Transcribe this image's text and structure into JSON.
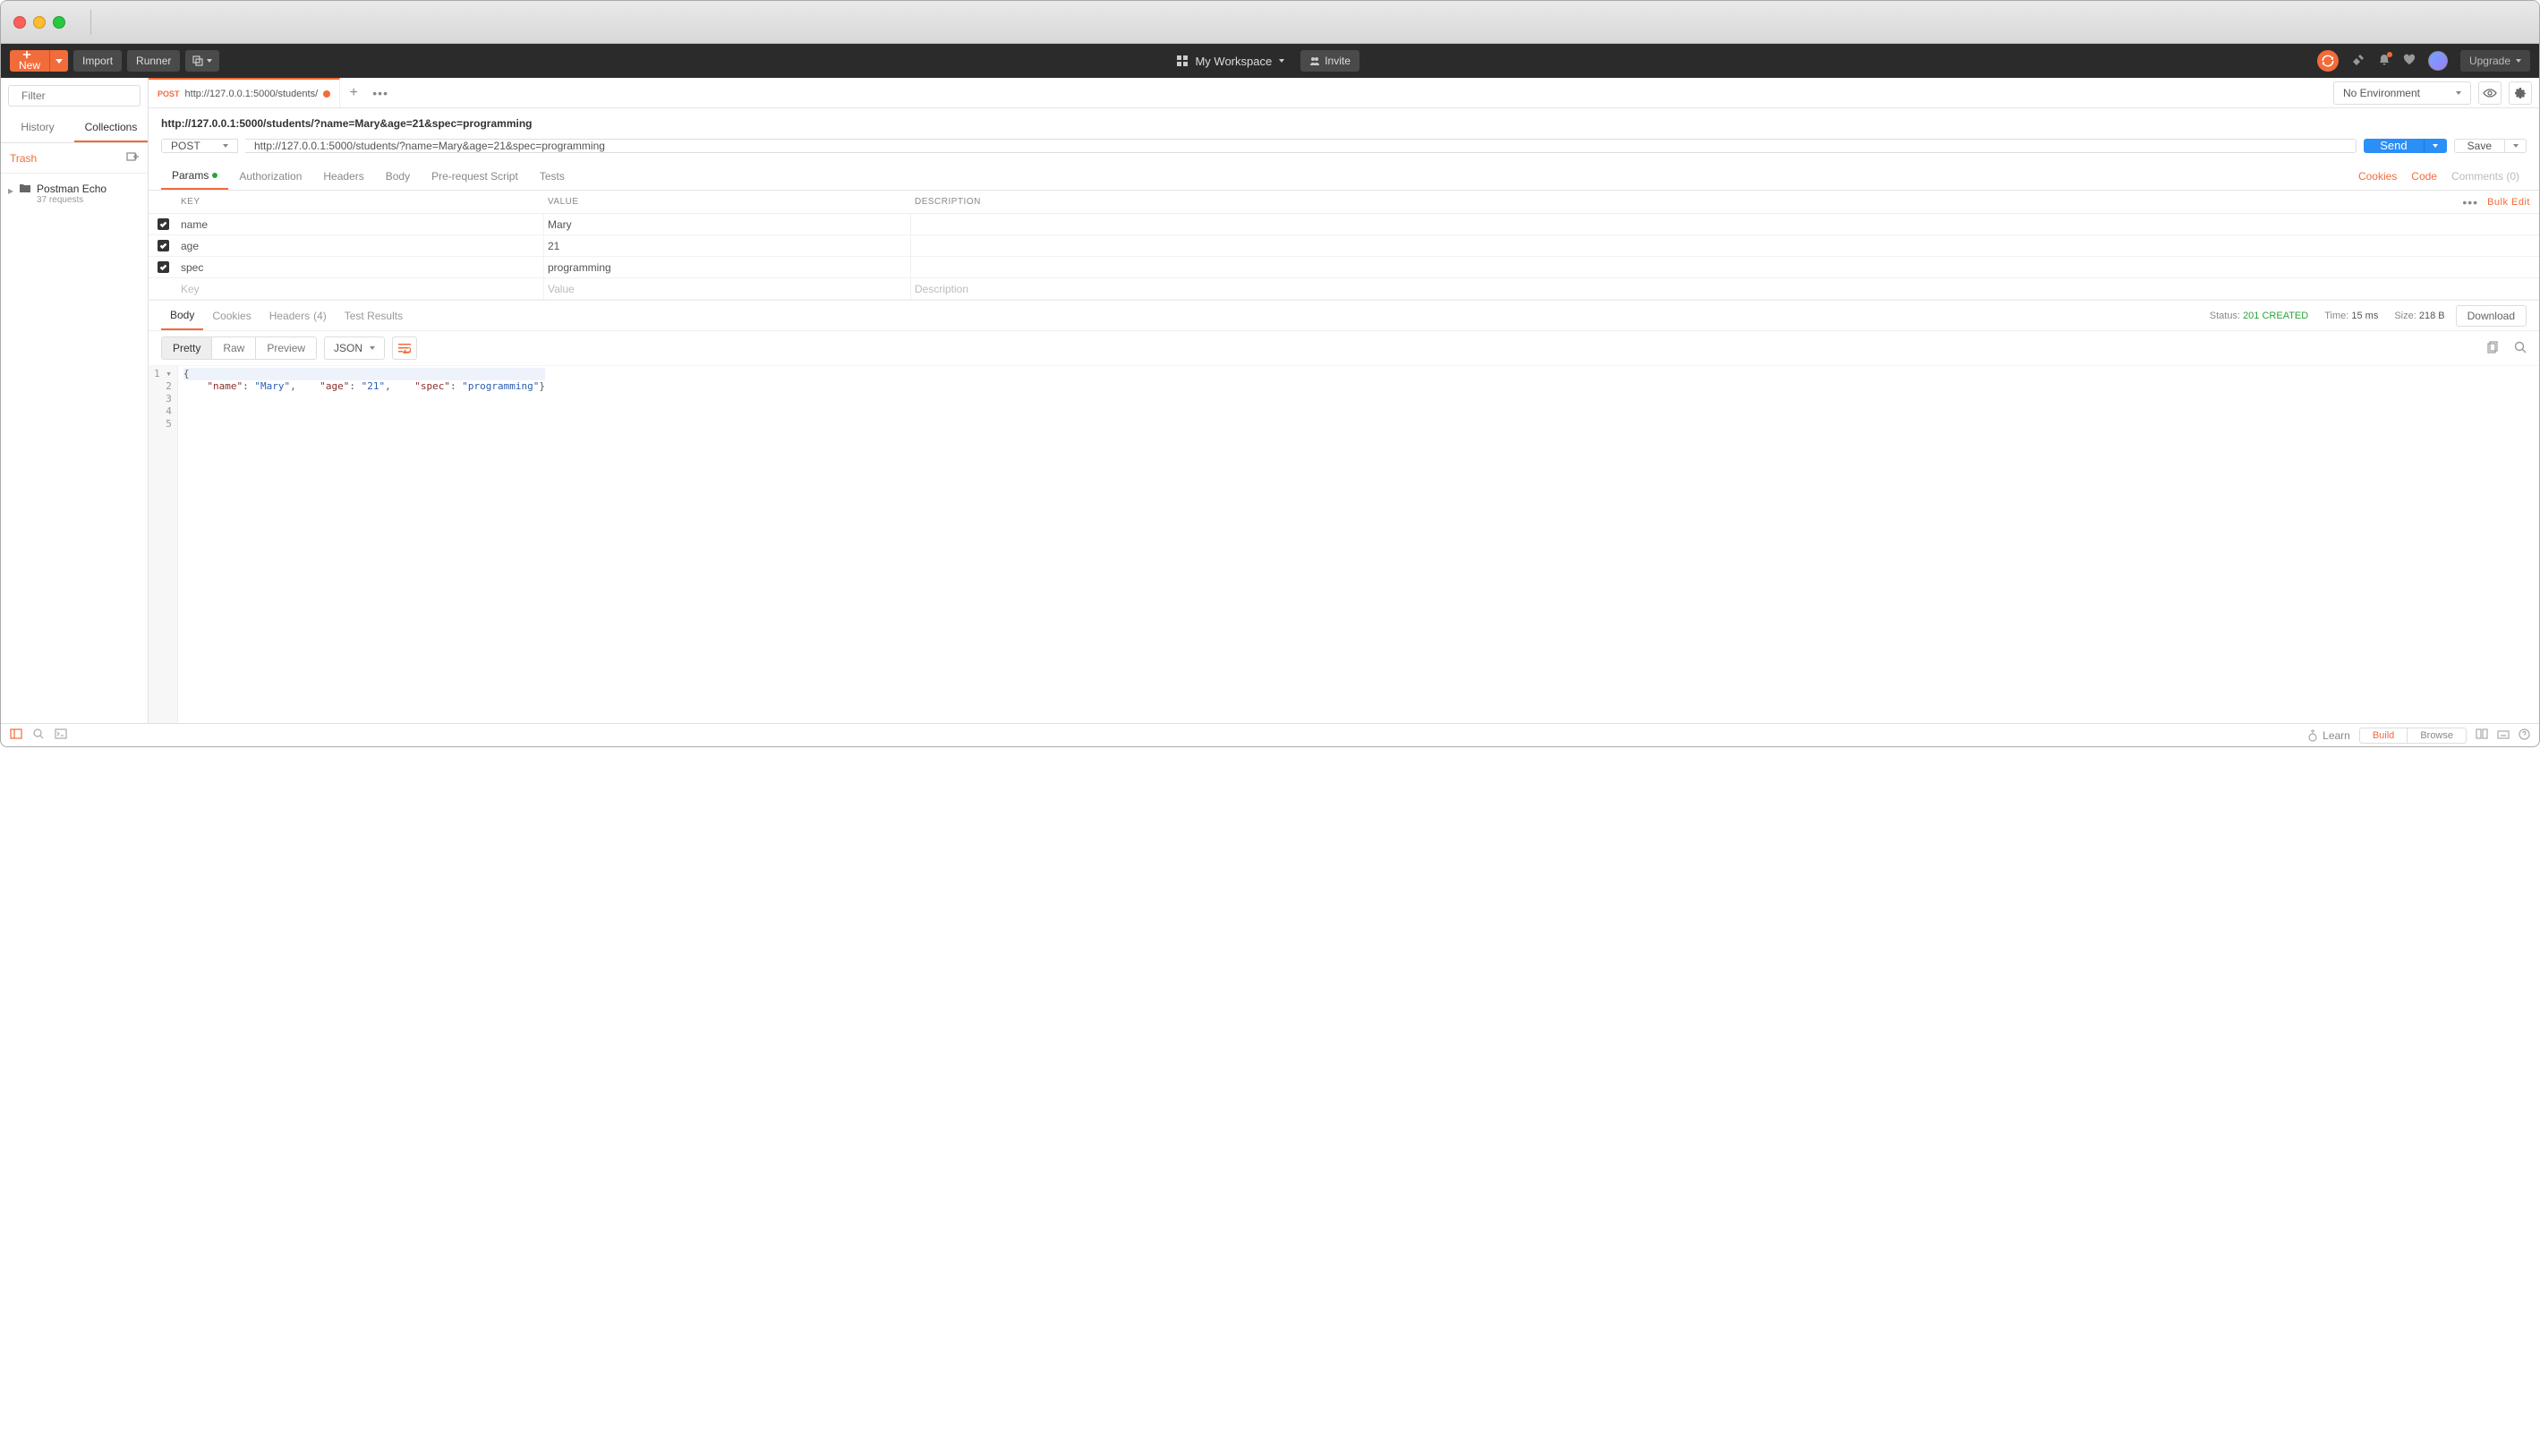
{
  "toolbar": {
    "new_label": "New",
    "import_label": "Import",
    "runner_label": "Runner",
    "workspace_label": "My Workspace",
    "invite_label": "Invite",
    "upgrade_label": "Upgrade"
  },
  "sidebar": {
    "filter_placeholder": "Filter",
    "tabs": {
      "history": "History",
      "collections": "Collections"
    },
    "trash_label": "Trash",
    "collections": [
      {
        "name": "Postman Echo",
        "sub": "37 requests"
      }
    ]
  },
  "request_tab": {
    "method": "POST",
    "short_url": "http://127.0.0.1:5000/students/",
    "title": "http://127.0.0.1:5000/students/?name=Mary&age=21&spec=programming"
  },
  "environment": {
    "selected": "No Environment"
  },
  "url_row": {
    "method": "POST",
    "url": "http://127.0.0.1:5000/students/?name=Mary&age=21&spec=programming",
    "send_label": "Send",
    "save_label": "Save"
  },
  "req_tabs": {
    "params": "Params",
    "authorization": "Authorization",
    "headers": "Headers",
    "body": "Body",
    "prerequest": "Pre-request Script",
    "tests": "Tests",
    "cookies": "Cookies",
    "code": "Code",
    "comments": "Comments (0)"
  },
  "params": {
    "headers": {
      "key": "KEY",
      "value": "VALUE",
      "description": "DESCRIPTION"
    },
    "bulk_edit": "Bulk Edit",
    "rows": [
      {
        "key": "name",
        "value": "Mary",
        "checked": true
      },
      {
        "key": "age",
        "value": "21",
        "checked": true
      },
      {
        "key": "spec",
        "value": "programming",
        "checked": true
      }
    ],
    "placeholder": {
      "key": "Key",
      "value": "Value",
      "description": "Description"
    }
  },
  "resp_tabs": {
    "body": "Body",
    "cookies": "Cookies",
    "headers": "Headers",
    "headers_count": "(4)",
    "tests": "Test Results"
  },
  "resp_meta": {
    "status_label": "Status:",
    "status_value": "201 CREATED",
    "time_label": "Time:",
    "time_value": "15 ms",
    "size_label": "Size:",
    "size_value": "218 B",
    "download": "Download"
  },
  "view_modes": {
    "pretty": "Pretty",
    "raw": "Raw",
    "preview": "Preview",
    "type": "JSON"
  },
  "response_body": {
    "name": "Mary",
    "age": "21",
    "spec": "programming"
  },
  "statusbar": {
    "learn": "Learn",
    "build": "Build",
    "browse": "Browse"
  }
}
